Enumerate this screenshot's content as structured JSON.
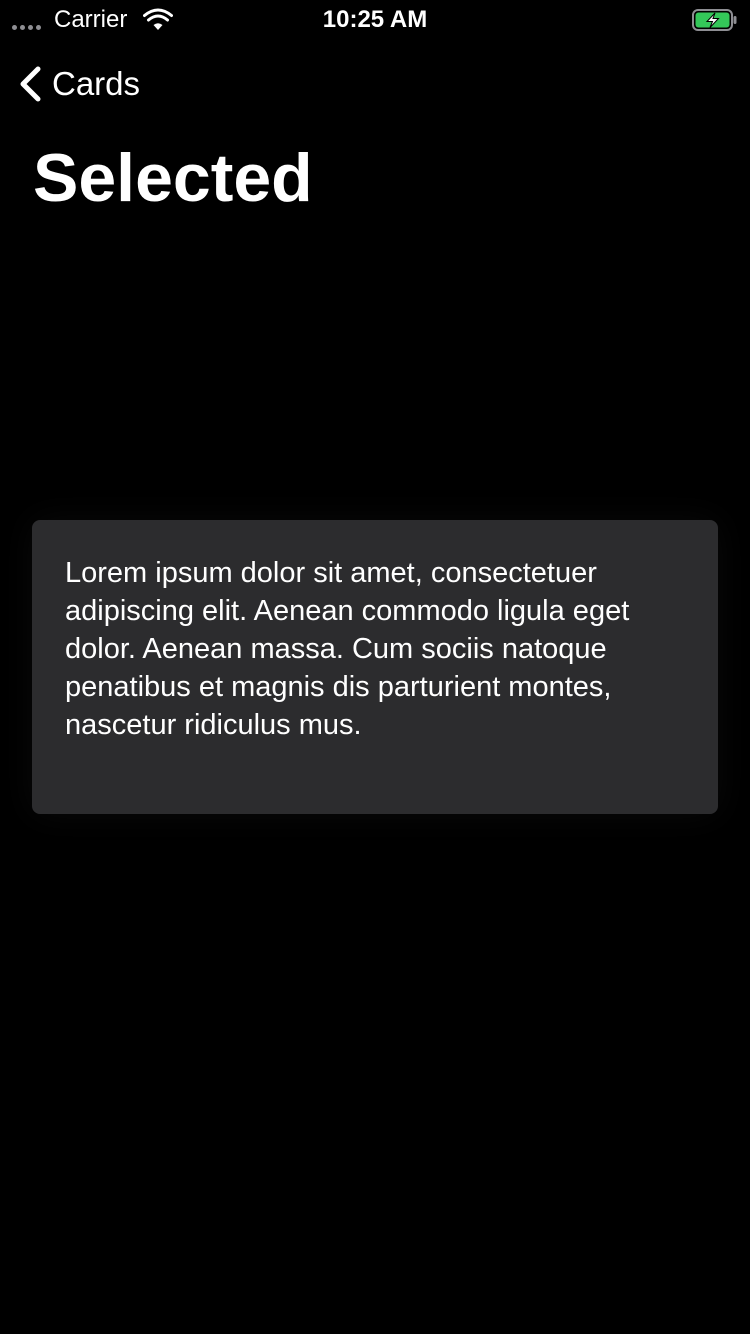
{
  "status_bar": {
    "carrier": "Carrier",
    "time": "10:25 AM",
    "signal_icon": "signal-dots-icon",
    "wifi_icon": "wifi-icon",
    "battery_icon": "battery-charging-icon",
    "battery_color": "#34c759"
  },
  "nav": {
    "back_label": "Cards",
    "back_icon": "chevron-left-icon",
    "title": "Selected"
  },
  "card": {
    "text": "Lorem ipsum dolor sit amet, consectetuer adipiscing elit. Aenean commodo ligula eget dolor. Aenean massa. Cum sociis natoque penatibus et magnis dis parturient montes, nascetur ridiculus mus.",
    "background": "#2c2c2e"
  },
  "colors": {
    "background": "#000000",
    "text": "#ffffff"
  }
}
